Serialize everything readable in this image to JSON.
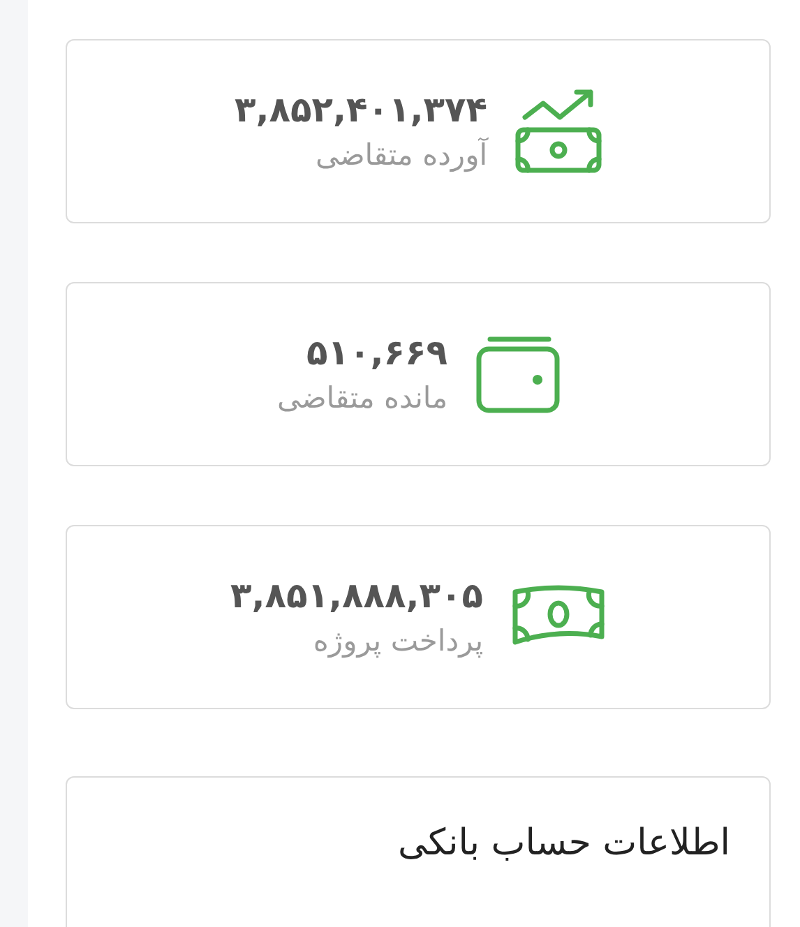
{
  "stats": [
    {
      "kind": "income",
      "value": "۳,۸۵۲,۴۰۱,۳۷۴",
      "label": "آورده متقاضی"
    },
    {
      "kind": "wallet",
      "value": "۵۱۰,۶۶۹",
      "label": "مانده متقاضی"
    },
    {
      "kind": "payment",
      "value": "۳,۸۵۱,۸۸۸,۳۰۵",
      "label": "پرداخت پروژه"
    }
  ],
  "bank_card": {
    "title": "اطلاعات حساب بانکی"
  }
}
